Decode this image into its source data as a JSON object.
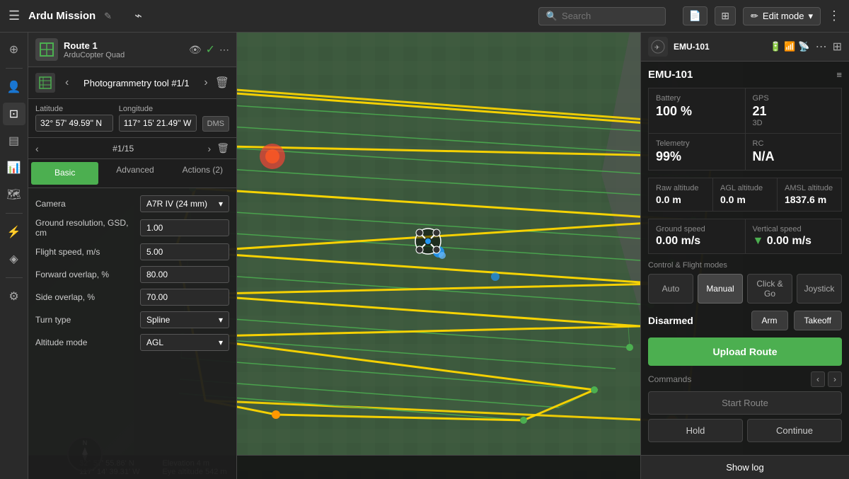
{
  "app": {
    "title": "Ardu Mission",
    "edit_mode": "Edit mode"
  },
  "topbar": {
    "search_placeholder": "Search",
    "more_icon": "⋮"
  },
  "route_panel": {
    "route_name": "Route 1",
    "route_type": "ArduCopter Quad",
    "tool_title": "Photogrammetry tool #1/1",
    "wp_count": "#1/15",
    "latitude_label": "Latitude",
    "longitude_label": "Longitude",
    "latitude_value": "32° 57' 49.59'' N",
    "longitude_value": "117° 15' 21.49'' W",
    "dms_label": "DMS",
    "tabs": [
      "Basic",
      "Advanced",
      "Actions (2)"
    ],
    "active_tab": "Basic",
    "params": [
      {
        "label": "Camera",
        "value": "A7R IV (24 mm)",
        "type": "select"
      },
      {
        "label": "Ground resolution, GSD, cm",
        "value": "1.00",
        "type": "input"
      },
      {
        "label": "Flight speed, m/s",
        "value": "5.00",
        "type": "input"
      },
      {
        "label": "Forward overlap, %",
        "value": "80.00",
        "type": "input"
      },
      {
        "label": "Side overlap, %",
        "value": "70.00",
        "type": "input"
      },
      {
        "label": "Turn type",
        "value": "Spline",
        "type": "select"
      },
      {
        "label": "Altitude mode",
        "value": "AGL",
        "type": "select"
      }
    ]
  },
  "emu": {
    "mini_name": "EMU-101",
    "title": "EMU-101",
    "battery_label": "Battery",
    "battery_value": "100 %",
    "gps_label": "GPS",
    "gps_value": "21",
    "gps_sub": "3D",
    "telemetry_label": "Telemetry",
    "telemetry_value": "99%",
    "rc_label": "RC",
    "rc_value": "N/A",
    "raw_alt_label": "Raw altitude",
    "raw_alt_value": "0.0 m",
    "agl_alt_label": "AGL altitude",
    "agl_alt_value": "0.0 m",
    "amsl_alt_label": "AMSL altitude",
    "amsl_alt_value": "1837.6 m",
    "ground_speed_label": "Ground speed",
    "ground_speed_value": "0.00 m/s",
    "vertical_speed_label": "Vertical speed",
    "vertical_speed_value": "0.00 m/s",
    "control_label": "Control & Flight modes",
    "modes": [
      "Auto",
      "Manual",
      "Click & Go",
      "Joystick"
    ],
    "active_mode": "Manual",
    "disarmed_label": "Disarmed",
    "arm_label": "Arm",
    "takeoff_label": "Takeoff",
    "upload_route_label": "Upload Route",
    "commands_label": "Commands",
    "start_route_label": "Start Route",
    "hold_label": "Hold",
    "continue_label": "Continue"
  },
  "bottom": {
    "coords": "32° 57' 55.86' N\n117° 14' 39.31' W",
    "elevation": "Elevation 4 m\nEye altitude 542 m",
    "show_log": "Show log",
    "compass_n": "N"
  },
  "sidebar": {
    "items": [
      {
        "icon": "⊕",
        "name": "add"
      },
      {
        "icon": "👤",
        "name": "profile"
      },
      {
        "icon": "✏️",
        "name": "edit"
      },
      {
        "icon": "📋",
        "name": "missions"
      },
      {
        "icon": "📊",
        "name": "data"
      },
      {
        "icon": "🗺",
        "name": "layers"
      },
      {
        "icon": "⚡",
        "name": "actions"
      },
      {
        "icon": "🔌",
        "name": "connect"
      },
      {
        "icon": "⚙",
        "name": "settings"
      }
    ]
  }
}
